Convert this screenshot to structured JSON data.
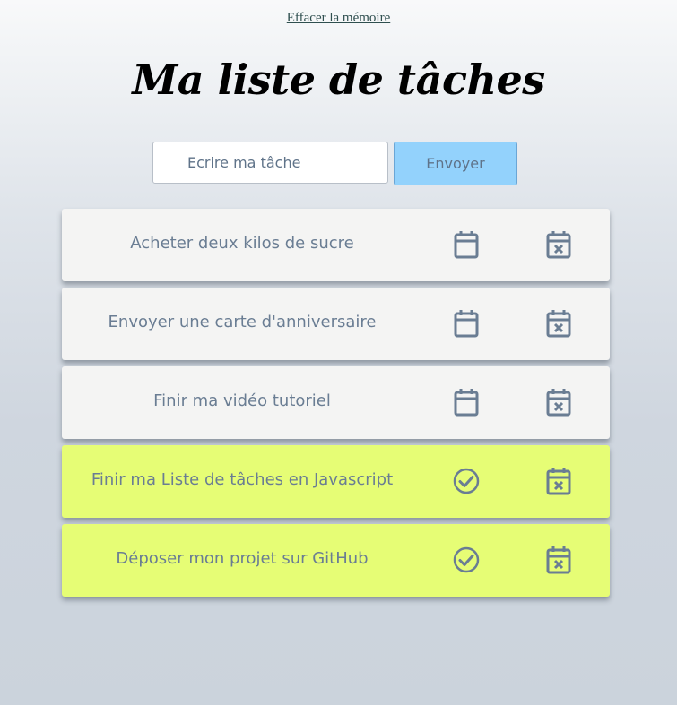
{
  "header": {
    "clear_memory_label": "Effacer la mémoire",
    "title": "Ma liste de tâches"
  },
  "form": {
    "input_placeholder": "Ecrire ma tâche",
    "input_value": "",
    "submit_label": "Envoyer"
  },
  "tasks": [
    {
      "label": "Acheter deux kilos de sucre",
      "done": false,
      "status_icon": "calendar-icon",
      "delete_icon": "calendar-x-icon"
    },
    {
      "label": "Envoyer une carte d'anniversaire",
      "done": false,
      "status_icon": "calendar-icon",
      "delete_icon": "calendar-x-icon"
    },
    {
      "label": "Finir ma vidéo tutoriel",
      "done": false,
      "status_icon": "calendar-icon",
      "delete_icon": "calendar-x-icon"
    },
    {
      "label": "Finir ma Liste de tâches en Javascript",
      "done": true,
      "status_icon": "check-circle-icon",
      "delete_icon": "calendar-x-icon"
    },
    {
      "label": "Déposer mon projet sur GitHub",
      "done": true,
      "status_icon": "check-circle-icon",
      "delete_icon": "calendar-x-icon"
    }
  ],
  "colors": {
    "pending_bg": "#f4f4f3",
    "done_bg": "#e6fd75",
    "icon": "#6a7d93",
    "button_bg": "#93d2fc",
    "text": "#6a7d93"
  }
}
